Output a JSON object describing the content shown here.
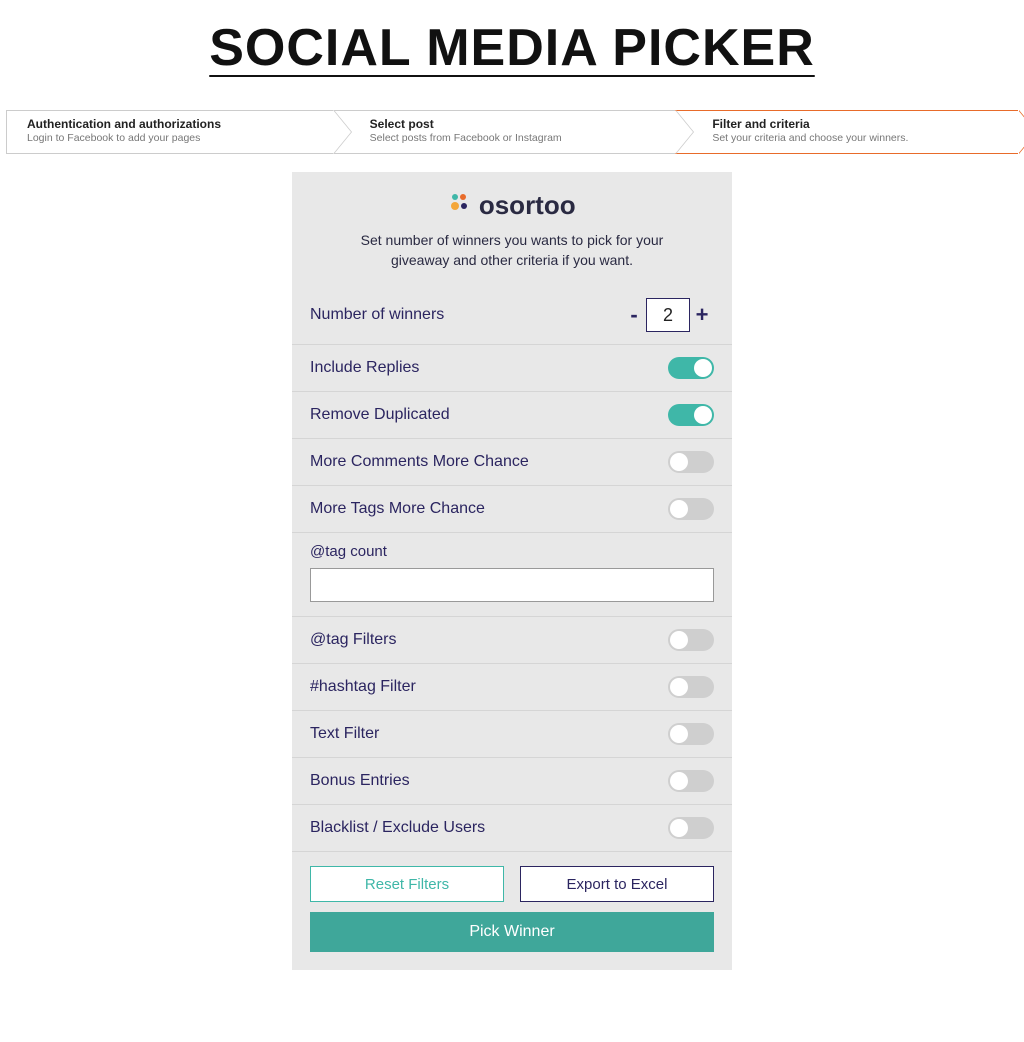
{
  "page": {
    "title": "SOCIAL MEDIA PICKER"
  },
  "steps": [
    {
      "title": "Authentication and authorizations",
      "sub": "Login to Facebook to add your pages",
      "active": false
    },
    {
      "title": "Select post",
      "sub": "Select posts from Facebook or Instagram",
      "active": false
    },
    {
      "title": "Filter and criteria",
      "sub": "Set your criteria and choose your winners.",
      "active": true
    }
  ],
  "logo": {
    "text": "osortoo"
  },
  "intro": "Set number of winners you wants to pick for your giveaway and other criteria if you want.",
  "winners": {
    "label": "Number of winners",
    "value": "2",
    "minus": "-",
    "plus": "+"
  },
  "toggles": {
    "include_replies": {
      "label": "Include Replies",
      "on": true
    },
    "remove_duplicated": {
      "label": "Remove Duplicated",
      "on": true
    },
    "more_comments": {
      "label": "More Comments More Chance",
      "on": false
    },
    "more_tags": {
      "label": "More Tags More Chance",
      "on": false
    },
    "tag_filters": {
      "label": "@tag Filters",
      "on": false
    },
    "hashtag_filter": {
      "label": "#hashtag Filter",
      "on": false
    },
    "text_filter": {
      "label": "Text Filter",
      "on": false
    },
    "bonus_entries": {
      "label": "Bonus Entries",
      "on": false
    },
    "blacklist": {
      "label": "Blacklist / Exclude Users",
      "on": false
    }
  },
  "tag_count": {
    "label": "@tag count",
    "value": ""
  },
  "actions": {
    "reset": "Reset Filters",
    "export": "Export to Excel",
    "pick": "Pick Winner"
  }
}
